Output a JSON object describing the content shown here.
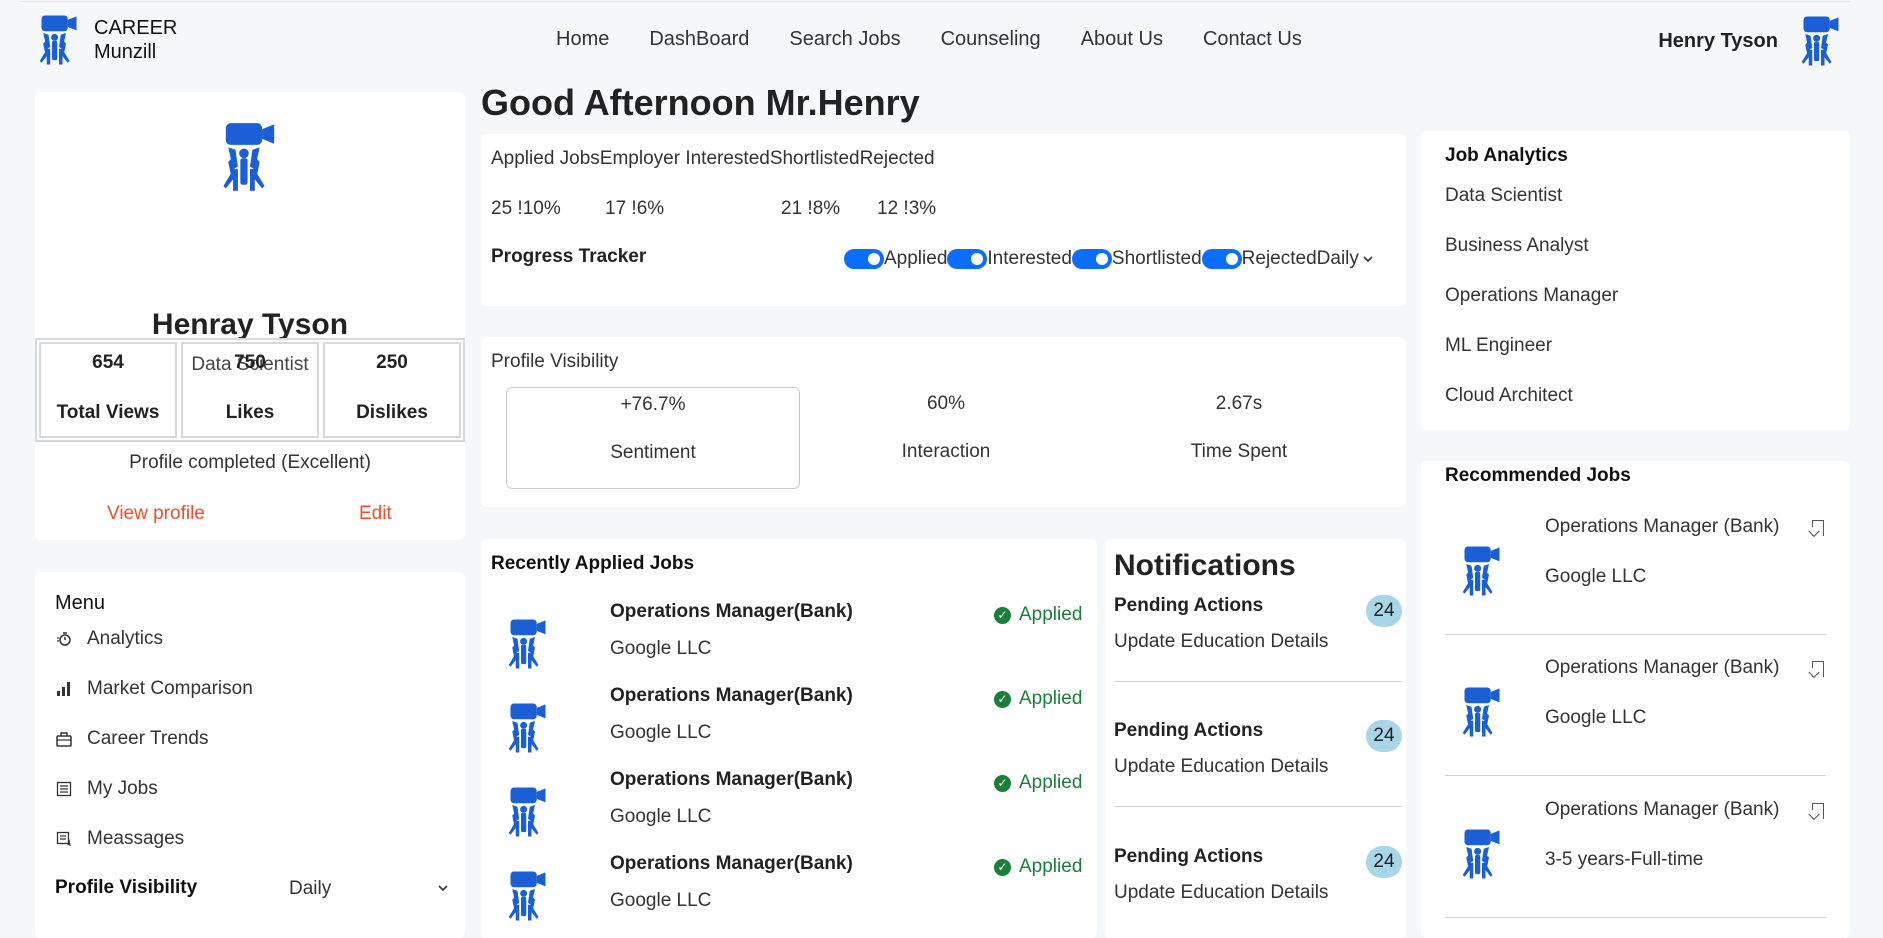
{
  "colors": {
    "brand_blue": "#1a5fd6",
    "accent_red": "#f04e2b",
    "success_green": "#1a7f37",
    "badge_blue": "#a8d6e6",
    "toggle_blue": "#0d6efd"
  },
  "header": {
    "brand_line1": "CAREER",
    "brand_line2": "Munzill",
    "nav": [
      "Home",
      "DashBoard",
      "Search Jobs",
      "Counseling",
      "About Us",
      "Contact Us"
    ],
    "user_name": "Henry Tyson"
  },
  "profile": {
    "name": "Henray Tyson",
    "role": "Data Scientist",
    "stats": [
      {
        "value": "654",
        "label": "Total Views"
      },
      {
        "value": "750",
        "label": "Likes"
      },
      {
        "value": "250",
        "label": "Dislikes"
      }
    ],
    "completed": "Profile completed (Excellent)",
    "view_profile": "View profile",
    "edit": "Edit"
  },
  "menu": {
    "title": "Menu",
    "items": [
      {
        "label": "Analytics",
        "icon": "timer-icon"
      },
      {
        "label": "Market Comparison",
        "icon": "bar-chart-icon"
      },
      {
        "label": "Career Trends",
        "icon": "briefcase-icon"
      },
      {
        "label": "My Jobs",
        "icon": "list-icon"
      },
      {
        "label": "Meassages",
        "icon": "message-icon"
      }
    ],
    "profile_visibility_label": "Profile Visibility",
    "profile_visibility_value": "Daily"
  },
  "greeting": "Good Afternoon Mr.Henry",
  "jobs_stats": {
    "heads": "Applied JobsEmployer InterestedShortlistedRejected",
    "values": [
      "25 !10%",
      "17 !6%",
      "21 !8%",
      "12 !3%"
    ],
    "progress_tracker": "Progress Tracker",
    "toggles": [
      "Applied",
      "Interested",
      "Shortlisted",
      "Rejected"
    ],
    "period": "Daily"
  },
  "visibility": {
    "title": "Profile Visibility",
    "metrics": [
      {
        "value": "+76.7%",
        "label": "Sentiment"
      },
      {
        "value": "60%",
        "label": "Interaction"
      },
      {
        "value": "2.67s",
        "label": "Time Spent"
      }
    ]
  },
  "recent": {
    "title": "Recently Applied Jobs",
    "items": [
      {
        "name": "Operations Manager(Bank)",
        "company": "Google LLC",
        "status": "Applied"
      },
      {
        "name": "Operations Manager(Bank)",
        "company": "Google LLC",
        "status": "Applied"
      },
      {
        "name": "Operations Manager(Bank)",
        "company": "Google LLC",
        "status": "Applied"
      },
      {
        "name": "Operations Manager(Bank)",
        "company": "Google LLC",
        "status": "Applied"
      }
    ]
  },
  "notifications": {
    "title": "Notifications",
    "items": [
      {
        "head": "Pending Actions",
        "text": "Update Education Details",
        "count": "24"
      },
      {
        "head": "Pending Actions",
        "text": "Update Education Details",
        "count": "24"
      },
      {
        "head": "Pending Actions",
        "text": "Update Education Details",
        "count": "24"
      }
    ]
  },
  "analytics": {
    "title": "Job Analytics",
    "items": [
      "Data Scientist",
      "Business Analyst",
      "Operations Manager",
      "ML Engineer",
      "Cloud Architect"
    ]
  },
  "recommended": {
    "title": "Recommended Jobs",
    "items": [
      {
        "name": "Operations Manager (Bank)",
        "sub": "Google LLC"
      },
      {
        "name": "Operations Manager (Bank)",
        "sub": "Google LLC"
      },
      {
        "name": "Operations Manager (Bank)",
        "sub": "3-5 years-Full-time"
      }
    ]
  }
}
